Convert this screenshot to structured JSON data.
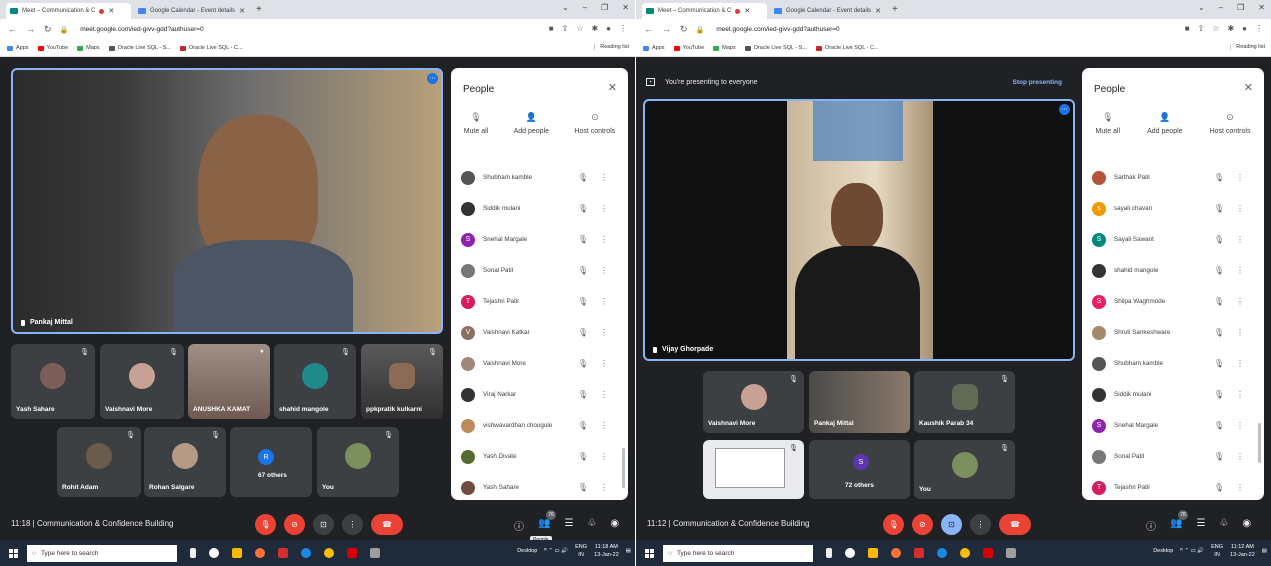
{
  "left": {
    "tabs": [
      "Meet – Communication & C",
      "Google Calendar - Event details"
    ],
    "url": "meet.google.com/ied-givv-gdd?authuser=0",
    "bookmarks": [
      "Apps",
      "YouTube",
      "Maps",
      "Oracle Live SQL - S...",
      "Oracle Live SQL - C..."
    ],
    "reading_list": "Reading list",
    "main_speaker": "Pankaj Mittal",
    "tiles_row1": [
      "Yash Sahare",
      "Vaishnavi More",
      "ANUSHKA KAMAT",
      "shahid mangole",
      "ppkpratik kulkarni"
    ],
    "tiles_row2": [
      "Rohit Adam",
      "Rohan Salgare",
      "67 others",
      "You"
    ],
    "others_initial": "R",
    "people": {
      "title": "People",
      "actions": [
        "Mute all",
        "Add people",
        "Host controls"
      ],
      "list": [
        {
          "name": "Shubham kamble",
          "initial": "",
          "color": "#555"
        },
        {
          "name": "Siddik mulani",
          "initial": "",
          "color": "#333"
        },
        {
          "name": "Snehal Margale",
          "initial": "S",
          "color": "#8e24aa"
        },
        {
          "name": "Sonal Patil",
          "initial": "",
          "color": "#777"
        },
        {
          "name": "Tejashri Patil",
          "initial": "T",
          "color": "#d81b60"
        },
        {
          "name": "Vaishnavi Katkar",
          "initial": "V",
          "color": "#8d6e63"
        },
        {
          "name": "Vaishnavi More",
          "initial": "",
          "color": "#a1887f"
        },
        {
          "name": "Viraj Narkar",
          "initial": "",
          "color": "#333"
        },
        {
          "name": "vishwavardhan chougule",
          "initial": "",
          "color": "#bf8a5a"
        },
        {
          "name": "Yash Divate",
          "initial": "",
          "color": "#556b2f"
        },
        {
          "name": "Yash Sahare",
          "initial": "",
          "color": "#6d4c41"
        }
      ]
    },
    "meeting": "11:18 | Communication & Confidence Building",
    "badge": "76",
    "tooltip": "People",
    "search": "Type here to search",
    "desktop": "Desktop",
    "lang": "ENG",
    "region": "IN",
    "time": "11:18 AM",
    "date": "13-Jan-22"
  },
  "right": {
    "tabs": [
      "Meet – Communication & C",
      "Google Calendar - Event details"
    ],
    "url": "meet.google.com/ied-givv-gdd?authuser=0",
    "bookmarks": [
      "Apps",
      "YouTube",
      "Maps",
      "Oracle Live SQL - S...",
      "Oracle Live SQL - C..."
    ],
    "reading_list": "Reading list",
    "presenting": "You're presenting to everyone",
    "stop": "Stop presenting",
    "main_speaker": "Vijay Ghorpade",
    "tiles_row1": [
      "Vaishnavi More",
      "Pankaj Mittal",
      "Kaushik Parab 34"
    ],
    "tiles_row2": [
      "",
      "72 others",
      "You"
    ],
    "others_initial": "S",
    "people": {
      "title": "People",
      "actions": [
        "Mute all",
        "Add people",
        "Host controls"
      ],
      "list": [
        {
          "name": "Sarthak Patil",
          "initial": "",
          "color": "#b5533c"
        },
        {
          "name": "sayali chavan",
          "initial": "s",
          "color": "#f29900"
        },
        {
          "name": "Sayali Sawant",
          "initial": "S",
          "color": "#00897b"
        },
        {
          "name": "shahid mangole",
          "initial": "",
          "color": "#333"
        },
        {
          "name": "Shilpa Waghmode",
          "initial": "S",
          "color": "#e91e63"
        },
        {
          "name": "Shruti Sankeshware",
          "initial": "",
          "color": "#a48a6a"
        },
        {
          "name": "Shubham kamble",
          "initial": "",
          "color": "#555"
        },
        {
          "name": "Siddik mulani",
          "initial": "",
          "color": "#333"
        },
        {
          "name": "Snehal Margale",
          "initial": "S",
          "color": "#8e24aa"
        },
        {
          "name": "Sonal Patil",
          "initial": "",
          "color": "#777"
        },
        {
          "name": "Tejashri Patil",
          "initial": "T",
          "color": "#d81b60"
        }
      ]
    },
    "meeting": "11:12 | Communication & Confidence Building",
    "badge": "78",
    "search": "Type here to search",
    "desktop": "Desktop",
    "lang": "ENG",
    "region": "IN",
    "time": "11:12 AM",
    "date": "13-Jan-22"
  }
}
